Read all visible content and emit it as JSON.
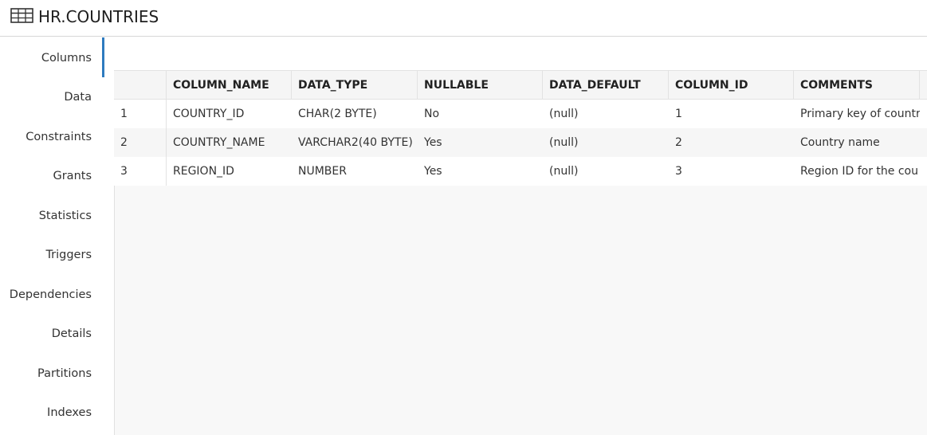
{
  "header": {
    "icon": "table-icon",
    "title": "HR.COUNTRIES"
  },
  "sidebar": {
    "active": "Columns",
    "items": [
      {
        "label": "Columns"
      },
      {
        "label": "Data"
      },
      {
        "label": "Constraints"
      },
      {
        "label": "Grants"
      },
      {
        "label": "Statistics"
      },
      {
        "label": "Triggers"
      },
      {
        "label": "Dependencies"
      },
      {
        "label": "Details"
      },
      {
        "label": "Partitions"
      },
      {
        "label": "Indexes"
      }
    ]
  },
  "grid": {
    "columns": [
      "",
      "COLUMN_NAME",
      "DATA_TYPE",
      "NULLABLE",
      "DATA_DEFAULT",
      "COLUMN_ID",
      "COMMENTS"
    ],
    "rows": [
      [
        "1",
        "COUNTRY_ID",
        "CHAR(2 BYTE)",
        "No",
        "(null)",
        "1",
        "Primary key of countr"
      ],
      [
        "2",
        "COUNTRY_NAME",
        "VARCHAR2(40 BYTE)",
        "Yes",
        "(null)",
        "2",
        "Country name"
      ],
      [
        "3",
        "REGION_ID",
        "NUMBER",
        "Yes",
        "(null)",
        "3",
        "Region ID for the cou"
      ]
    ]
  },
  "colors": {
    "accent": "#2e7bbf"
  }
}
